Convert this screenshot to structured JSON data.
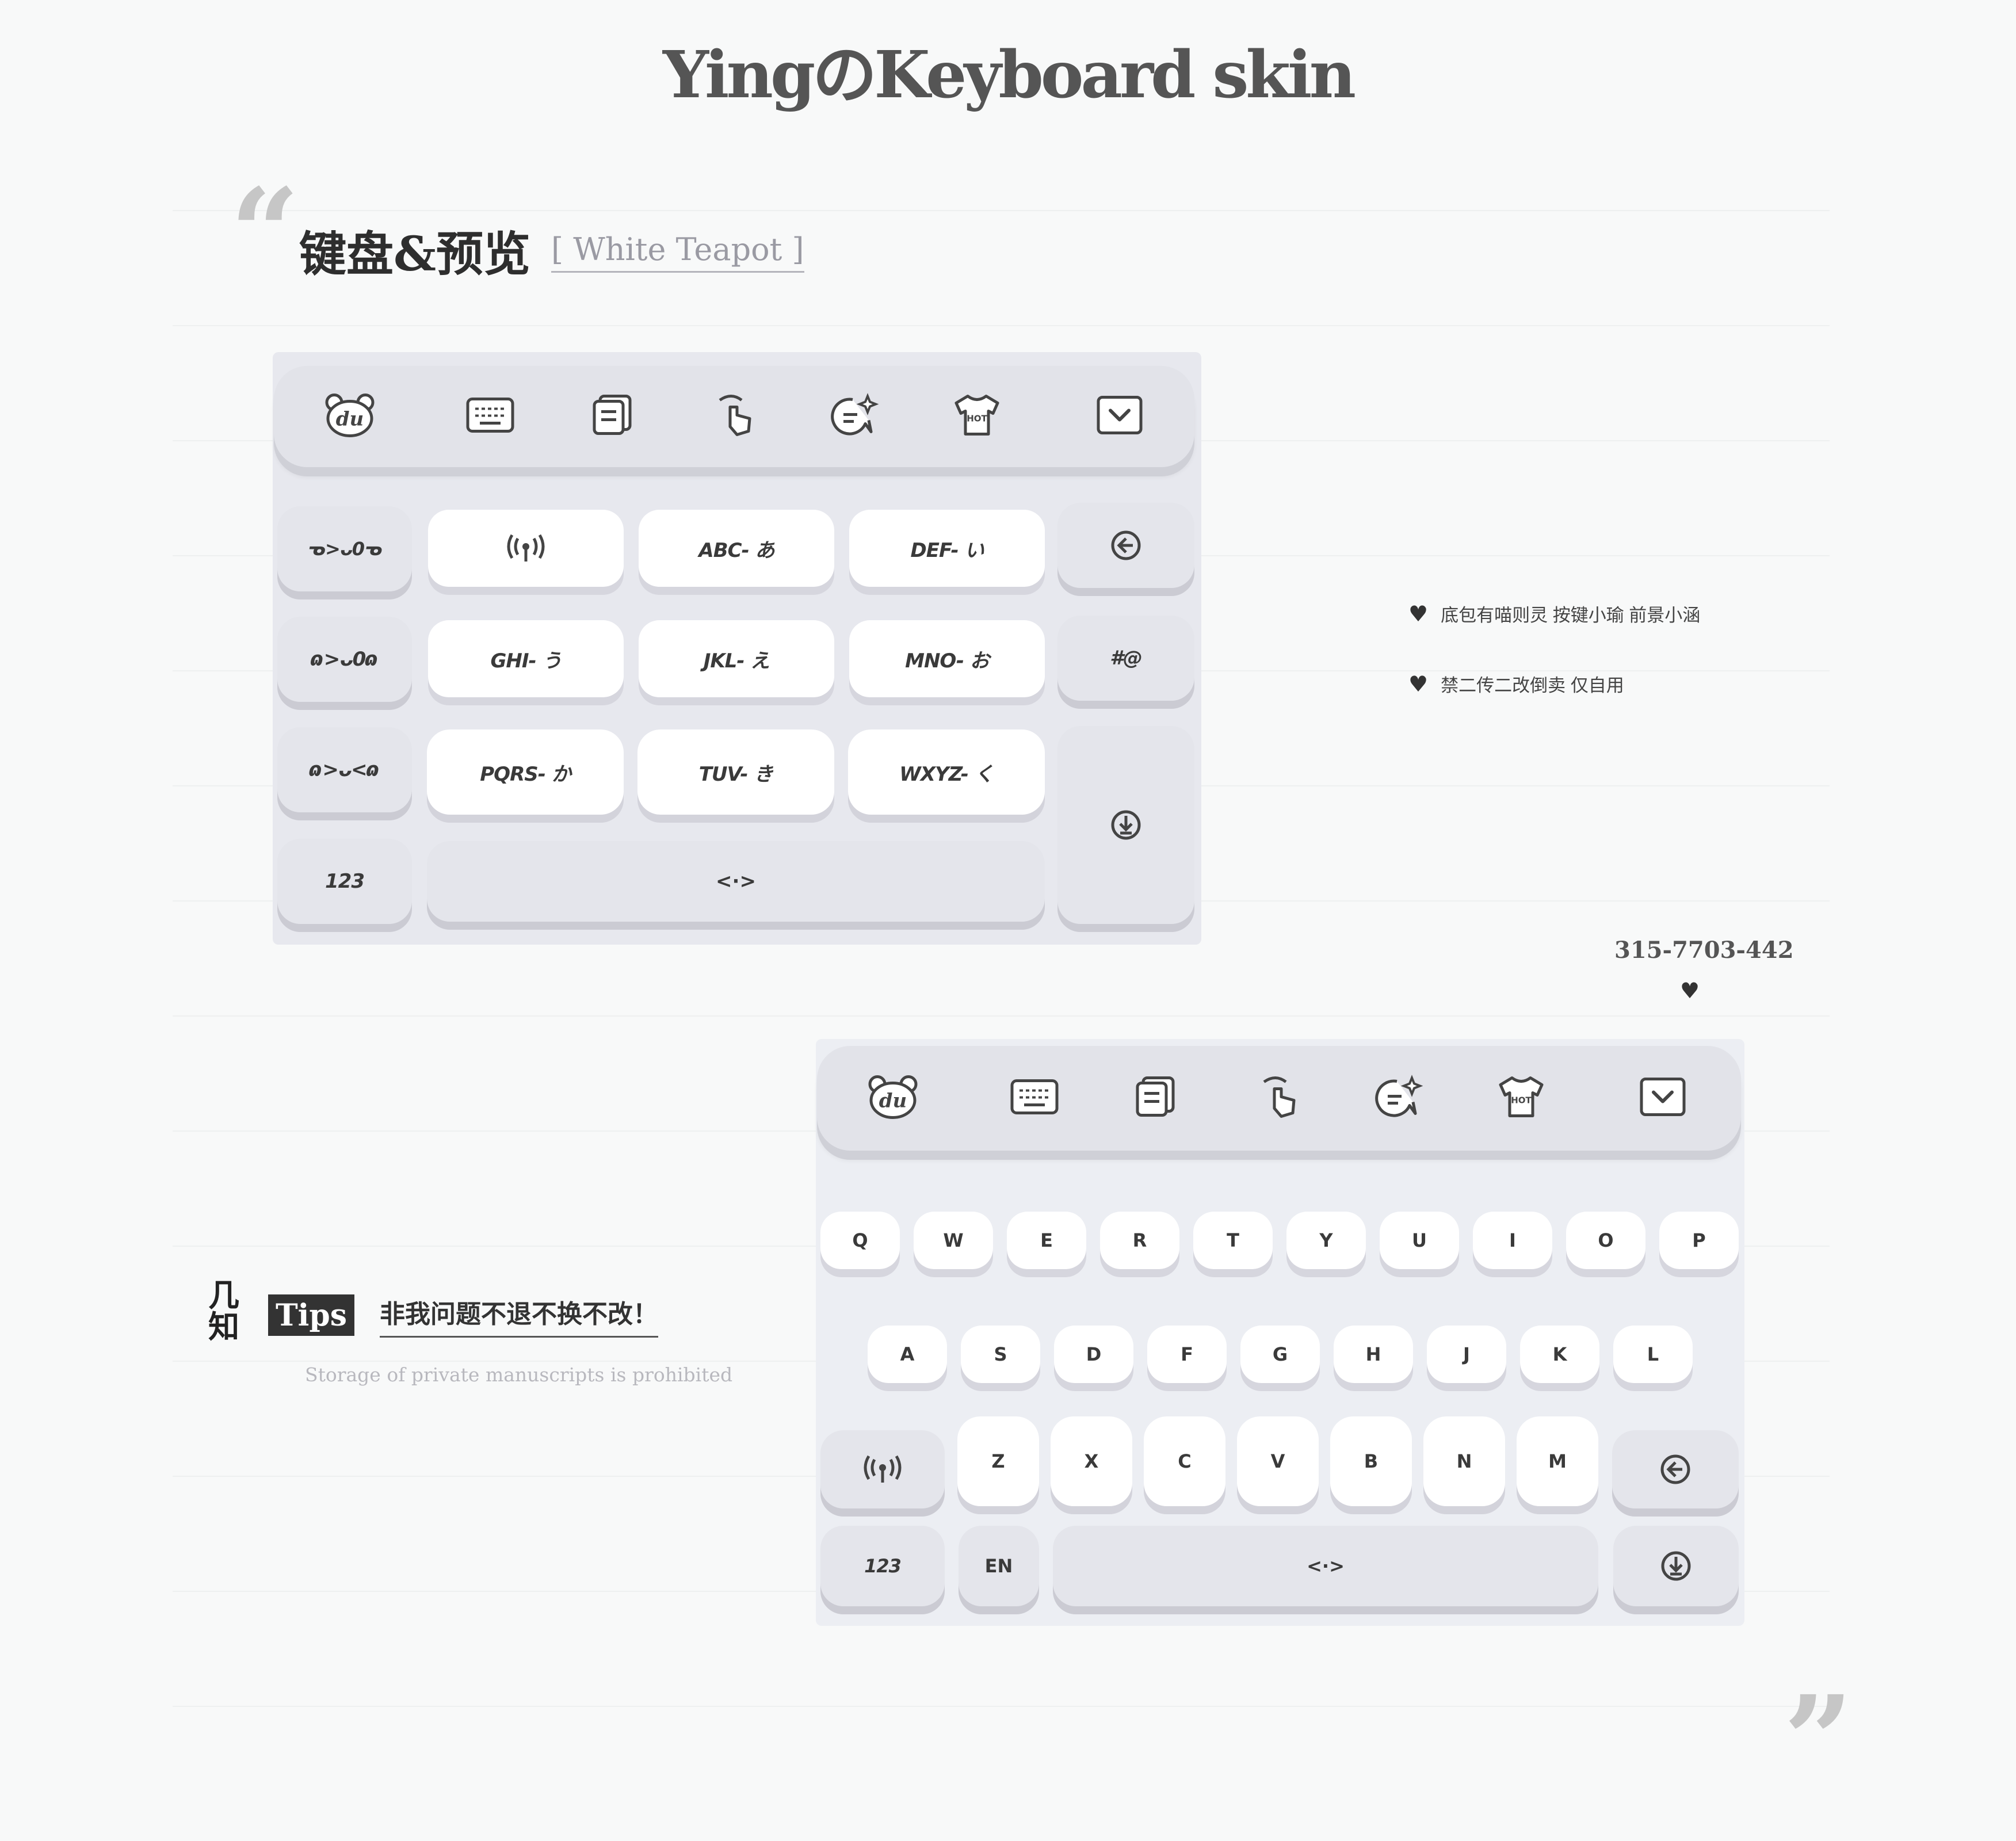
{
  "page": {
    "title": "YingのKeyboard skin",
    "open_quote": "“",
    "close_quote": "”"
  },
  "section": {
    "title": "键盘&预览",
    "subtitle": "[ White Teapot ]"
  },
  "notes": [
    "底包有喵则灵 按键小瑜 前景小涵",
    "禁二传二改倒卖 仅自用"
  ],
  "phone": "315-7703-442",
  "heart": "♥",
  "tips": {
    "side_label": "几\n知",
    "badge": "Tips",
    "text": "非我问题不退不换不改！",
    "english": "Storage of private manuscripts is prohibited"
  },
  "keyboard1": {
    "toolbar_icons": [
      "bear-du-icon",
      "keyboard-icon",
      "clipboard-icon",
      "gesture-icon",
      "chat-sparkle-icon",
      "hot-shirt-icon",
      "collapse-icon"
    ],
    "emoticons": [
      "ᓀ>ᴗ0ᓀ",
      "ɷ>ᴗ0ɷ",
      "ɷ>ᴗ<ɷ"
    ],
    "rows": [
      [
        "((•))",
        "ABC- あ",
        "DEF- い"
      ],
      [
        "GHI- う",
        "JKL- え",
        "MNO- お"
      ],
      [
        "PQRS- か",
        "TUV- き",
        "WXYZ- く"
      ]
    ],
    "right_keys": [
      "backspace-icon",
      "#@",
      "enter-icon"
    ],
    "bottom": {
      "num": "123",
      "space": "<·>"
    }
  },
  "keyboard2": {
    "toolbar_icons": [
      "bear-du-icon",
      "keyboard-icon",
      "clipboard-icon",
      "gesture-icon",
      "chat-sparkle-icon",
      "hot-shirt-icon",
      "collapse-icon"
    ],
    "row1": [
      "Q",
      "W",
      "E",
      "R",
      "T",
      "Y",
      "U",
      "I",
      "O",
      "P"
    ],
    "row2": [
      "A",
      "S",
      "D",
      "F",
      "G",
      "H",
      "J",
      "K",
      "L"
    ],
    "row3": [
      "Z",
      "X",
      "C",
      "V",
      "B",
      "N",
      "M"
    ],
    "bottom": {
      "num": "123",
      "lang": "EN",
      "space": "<·>"
    }
  },
  "colors": {
    "background": "#f8f9f9",
    "key": "#e4e5eb",
    "key_white": "#ffffff",
    "shadow": "#cbcbd3",
    "text": "#333333"
  }
}
